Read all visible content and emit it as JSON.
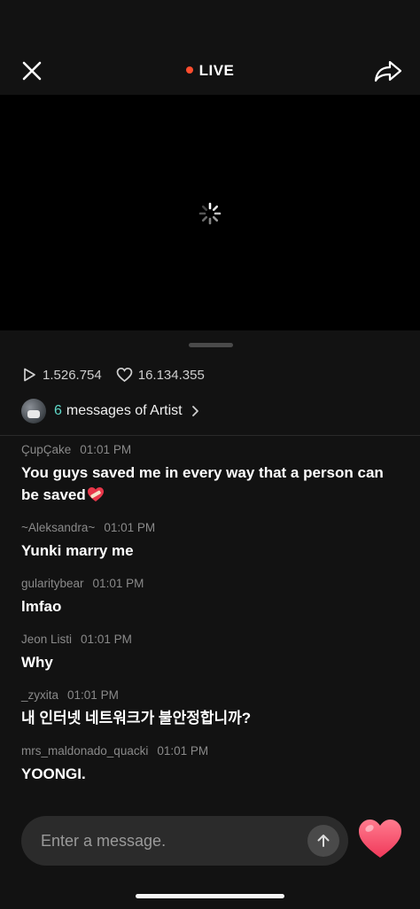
{
  "header": {
    "live_label": "LIVE",
    "live_color": "#ff4d2e"
  },
  "stats": {
    "plays": "1.526.754",
    "likes": "16.134.355"
  },
  "artist_messages": {
    "count": "6",
    "label": "messages of Artist",
    "accent": "#5fd8c8"
  },
  "messages": [
    {
      "user": "ÇupÇake",
      "time": "01:01 PM",
      "text": "You guys saved me in every way that a person can be saved",
      "emoji": "heart-with-bandage"
    },
    {
      "user": "~Aleksandra~",
      "time": "01:01 PM",
      "text": "Yunki marry me"
    },
    {
      "user": "gularitybear",
      "time": "01:01 PM",
      "text": "lmfao"
    },
    {
      "user": "Jeon Listi",
      "time": "01:01 PM",
      "text": "Why"
    },
    {
      "user": "_zyxita",
      "time": "01:01 PM",
      "text": "내 인터넷 네트워크가 불안정합니까?"
    },
    {
      "user": "mrs_maldonado_quacki",
      "time": "01:01 PM",
      "text": "YOONGI."
    }
  ],
  "composer": {
    "placeholder": "Enter a message."
  },
  "icons": {
    "close": "close-icon",
    "share": "share-icon",
    "spinner": "loading-spinner-icon",
    "play": "play-icon",
    "like_outline": "heart-outline-icon",
    "send": "arrow-up-icon",
    "like": "heart-icon"
  }
}
